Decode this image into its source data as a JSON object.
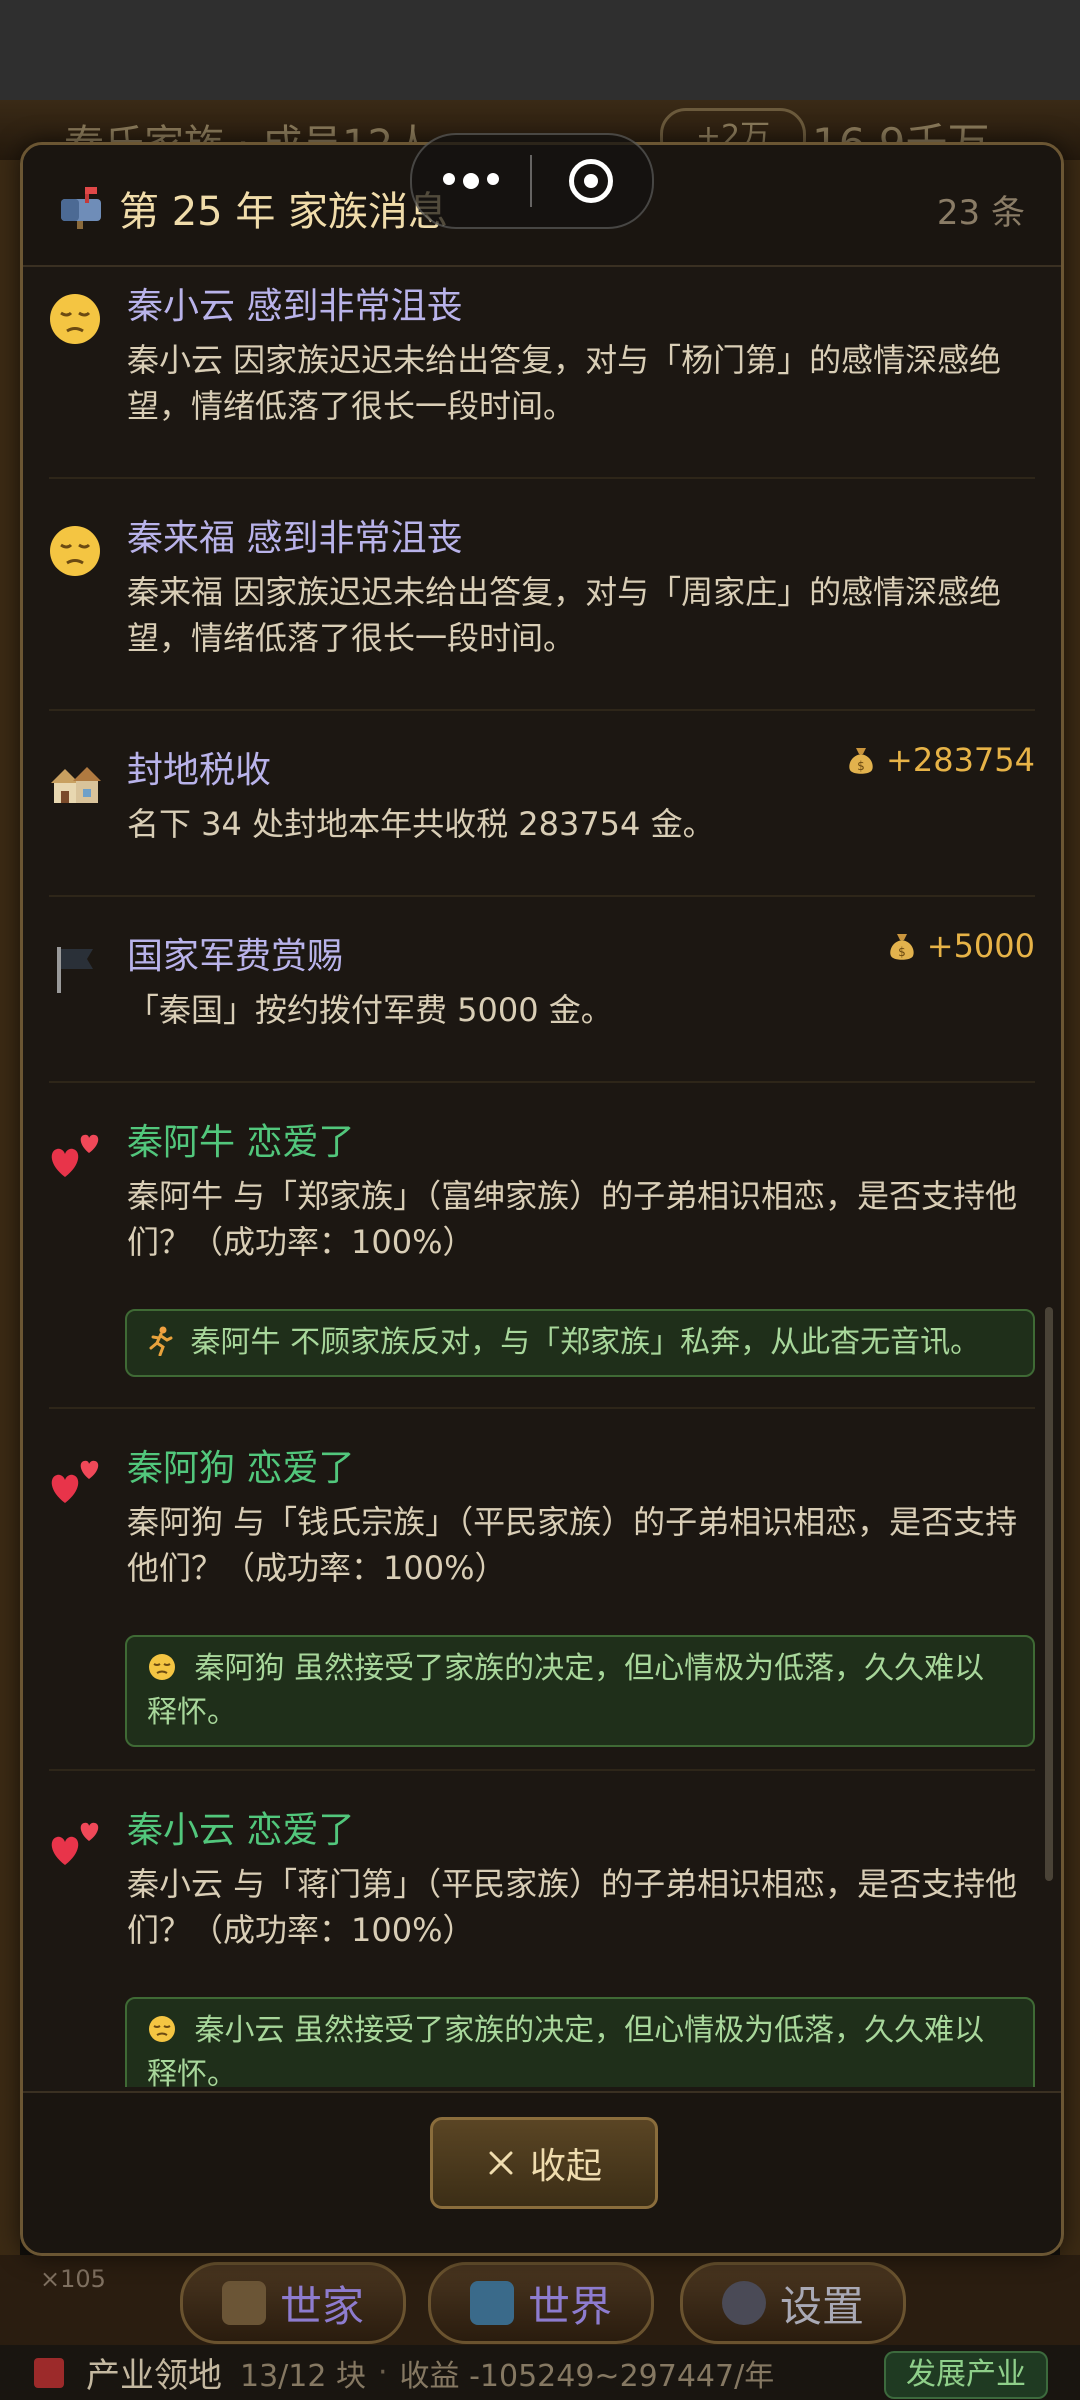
{
  "background": {
    "top_text": "秦氏家族 · 成员12人",
    "top_badge": "+2万",
    "top_gold": "16.9千万",
    "nav_small": "×105",
    "nav_buttons": [
      {
        "label": "世家"
      },
      {
        "label": "世界"
      },
      {
        "label": "设置"
      }
    ],
    "bottom_bar": {
      "title": "产业领地",
      "count": "13/12 块",
      "separator": "·",
      "income": "收益 -105249~297447/年",
      "button": "发展产业"
    }
  },
  "modal": {
    "header": {
      "title": "第 25 年  家族消息",
      "count": "23 条",
      "icon": "mailbox-icon"
    },
    "items": [
      {
        "icon": "pensive-face-icon",
        "title": "秦小云 感到非常沮丧",
        "body": "秦小云 因家族迟迟未给出答复，对与「杨门第」的感情深感绝望，情绪低落了很长一段时间。"
      },
      {
        "icon": "pensive-face-icon",
        "title": "秦来福 感到非常沮丧",
        "body": "秦来福 因家族迟迟未给出答复，对与「周家庄」的感情深感绝望，情绪低落了很长一段时间。"
      },
      {
        "icon": "houses-icon",
        "title": "封地税收",
        "amount": "+283754",
        "body": "名下 34 处封地本年共收税 283754 金。"
      },
      {
        "icon": "black-flag-icon",
        "title": "国家军费赏赐",
        "amount": "+5000",
        "body": "「秦国」按约拨付军费 5000 金。"
      },
      {
        "icon": "two-hearts-icon",
        "title": "秦阿牛 恋爱了",
        "body": "秦阿牛 与「郑家族」（富绅家族）的子弟相识相恋，是否支持他们？（成功率：100%）",
        "result_icon": "running-person-icon",
        "result": "秦阿牛 不顾家族反对，与「郑家族」私奔，从此杳无音讯。"
      },
      {
        "icon": "two-hearts-icon",
        "title": "秦阿狗 恋爱了",
        "body": "秦阿狗 与「钱氏宗族」（平民家族）的子弟相识相恋，是否支持他们？（成功率：100%）",
        "result_icon": "pensive-face-icon",
        "result": "秦阿狗 虽然接受了家族的决定，但心情极为低落，久久难以释怀。"
      },
      {
        "icon": "two-hearts-icon",
        "title": "秦小云 恋爱了",
        "body": "秦小云 与「蒋门第」（平民家族）的子弟相识相恋，是否支持他们？（成功率：100%）",
        "result_icon": "pensive-face-icon",
        "result": "秦小云 虽然接受了家族的决定，但心情极为低落，久久难以释怀。"
      }
    ],
    "footer": {
      "collapse_label": "收起"
    }
  },
  "colors": {
    "accent_gold": "#e7b347",
    "title_purple": "#b9b3ea",
    "love_green": "#52c77c",
    "result_bg": "#1f2f1a"
  }
}
